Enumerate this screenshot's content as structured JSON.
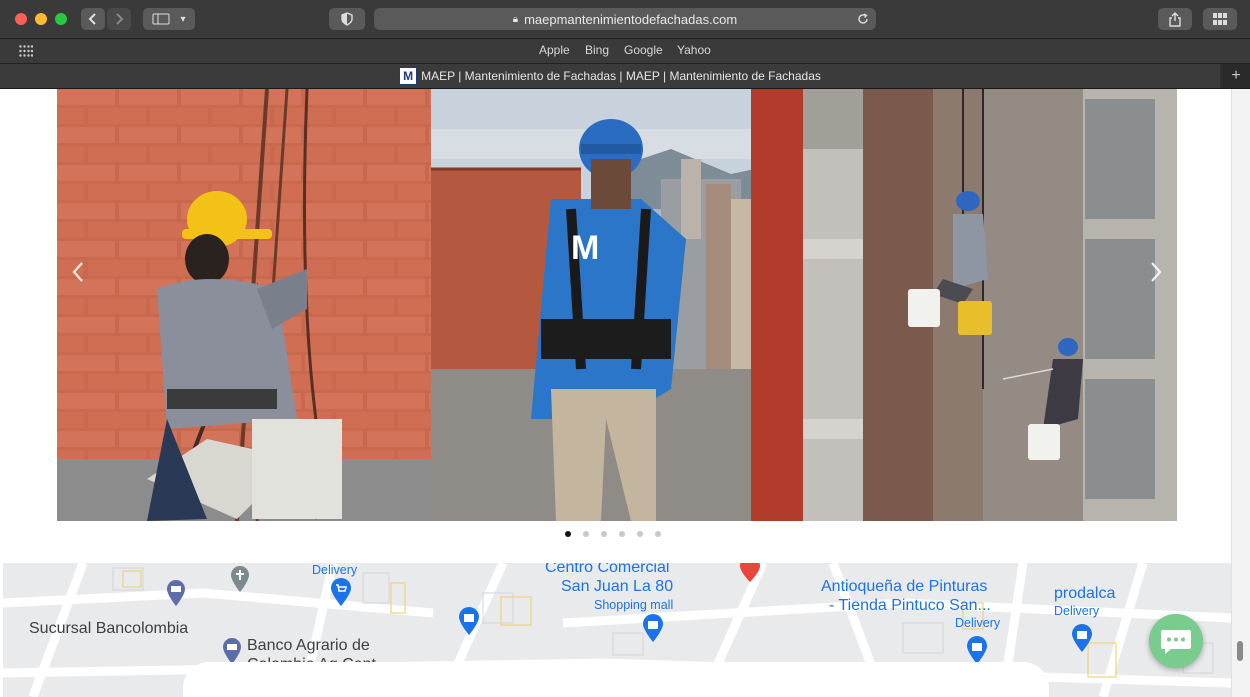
{
  "browser": {
    "url": "maepmantenimientodefachadas.com",
    "tab_title": "MAEP | Mantenimiento de Fachadas | MAEP | Mantenimiento de Fachadas",
    "favicon_letter": "M",
    "favorites": [
      "Apple",
      "Bing",
      "Google",
      "Yahoo"
    ],
    "new_tab_label": "+"
  },
  "carousel": {
    "slides": [
      {
        "alt": "Worker with yellow helmet on brick facade"
      },
      {
        "alt": "Worker in blue MAEP shirt overlooking city"
      },
      {
        "alt": "Workers cleaning building facade"
      }
    ],
    "prev_icon": "chevron-left-icon",
    "next_icon": "chevron-right-icon",
    "dot_count": 6,
    "active_dot": 1
  },
  "map": {
    "labels": {
      "delivery_1": "Delivery",
      "centro": "Centro Comercial",
      "sanjuan": "San Juan La 80",
      "shopping": "Shopping mall",
      "antioquena1": "Antioqueña de Pinturas",
      "antioquena2": "- Tienda Pintuco San...",
      "prodalca": "prodalca",
      "delivery_2": "Delivery",
      "delivery_3": "Delivery",
      "sucursal": "Sucursal Bancolombia",
      "banco1": "Banco Agrario de",
      "banco2": "Colombia Ag Cent..."
    }
  },
  "chat_widget": {
    "icon": "chat-bubble-icon"
  },
  "colors": {
    "chat": "#79cb8e",
    "map_blue": "#1a73e8",
    "toolbar": "#3a3a3a"
  }
}
